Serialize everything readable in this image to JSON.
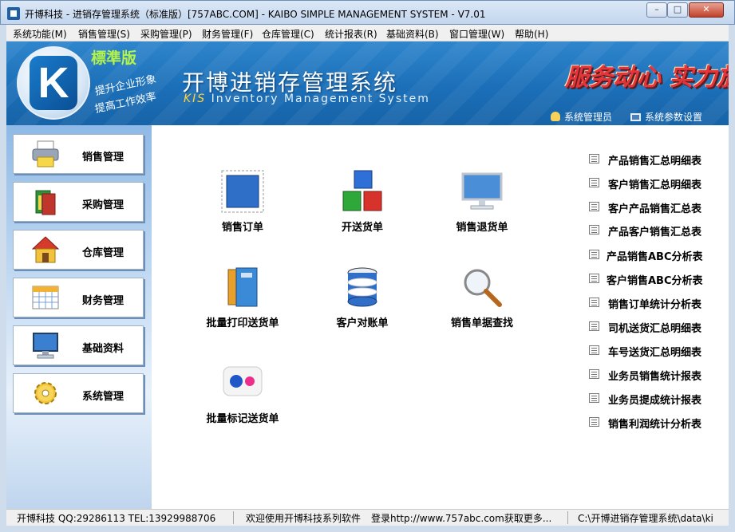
{
  "window": {
    "title": "开博科技 - 进销存管理系统（标准版）[757ABC.COM] - KAIBO SIMPLE MANAGEMENT SYSTEM - V7.01",
    "min_glyph": "–",
    "max_glyph": "□",
    "close_glyph": "✕"
  },
  "menu": [
    "系统功能(M)",
    "销售管理(S)",
    "采购管理(P)",
    "财务管理(F)",
    "仓库管理(C)",
    "统计报表(R)",
    "基础资料(B)",
    "窗口管理(W)",
    "帮助(H)"
  ],
  "banner": {
    "logo_letter": "K",
    "edition": "標準版",
    "slogan_line1": "提升企业形象",
    "slogan_line2": "提高工作效率",
    "title": "开博进销存管理系统",
    "subtitle_prefix": "KIS",
    "subtitle": "Inventory Management System",
    "motto": "服务动心 实力放心",
    "admin_label": "系统管理员",
    "settings_label": "系统参数设置"
  },
  "sidebar": [
    {
      "label": "销售管理",
      "icon": "printer-icon"
    },
    {
      "label": "采购管理",
      "icon": "books-icon"
    },
    {
      "label": "仓库管理",
      "icon": "house-icon"
    },
    {
      "label": "财务管理",
      "icon": "calendar-icon"
    },
    {
      "label": "基础资料",
      "icon": "monitor-icon"
    },
    {
      "label": "系统管理",
      "icon": "gear-icon"
    }
  ],
  "tiles": [
    {
      "label": "销售订单",
      "icon": "stamp-icon"
    },
    {
      "label": "开送货单",
      "icon": "cubes-icon"
    },
    {
      "label": "销售退货单",
      "icon": "monitor-icon"
    },
    {
      "label": "批量打印送货单",
      "icon": "folders-icon"
    },
    {
      "label": "客户对账单",
      "icon": "database-icon"
    },
    {
      "label": "销售单据查找",
      "icon": "magnifier-icon"
    },
    {
      "label": "批量标记送货单",
      "icon": "flickr-dots-icon"
    }
  ],
  "reports": [
    "产品销售汇总明细表",
    "客户销售汇总明细表",
    "客户产品销售汇总表",
    "产品客户销售汇总表",
    "产品销售ABC分析表",
    "客户销售ABC分析表",
    "销售订单统计分析表",
    "司机送货汇总明细表",
    "车号送货汇总明细表",
    "业务员销售统计报表",
    "业务员提成统计报表",
    "销售利润统计分析表"
  ],
  "status": {
    "company": "开博科技 QQ:29286113 TEL:13929988706",
    "welcome": "欢迎使用开博科技系列软件",
    "website": "登录http://www.757abc.com获取更多...",
    "path": "C:\\开博进销存管理系统\\data\\ki"
  },
  "colors": {
    "banner": "#1b6fb8",
    "edition": "#b4f34a",
    "motto": "#e5343a"
  }
}
